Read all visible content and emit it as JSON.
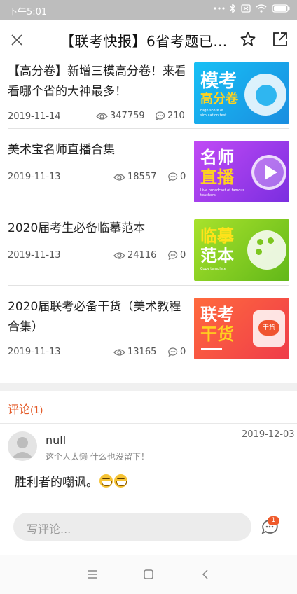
{
  "status_bar": {
    "time": "下午5:01"
  },
  "header": {
    "title": "【联考快报】6省考题已出..."
  },
  "articles": [
    {
      "title": "【高分卷】新增三模高分卷！来看看哪个省的大神最多！",
      "date": "2019-11-14",
      "views": "347759",
      "comments": "210",
      "thumb": {
        "line1": "模考",
        "line2": "高分卷",
        "sub": "High score of simulation test",
        "bg": "#1fb3ea"
      }
    },
    {
      "title": "美术宝名师直播合集",
      "date": "2019-11-13",
      "views": "18557",
      "comments": "0",
      "thumb": {
        "line1": "名师",
        "line2": "直播",
        "sub": "Live broadcast of famous teachers",
        "bg": "#9b3df0"
      }
    },
    {
      "title": "2020届考生必备临摹范本",
      "date": "2019-11-13",
      "views": "24116",
      "comments": "0",
      "thumb": {
        "line1": "临摹",
        "line2": "范本",
        "sub": "Copy template",
        "bg": "#8ad224"
      }
    },
    {
      "title": "2020届联考必备干货（美术教程合集）",
      "date": "2019-11-13",
      "views": "13165",
      "comments": "0",
      "thumb": {
        "line1": "联考",
        "line2": "干货",
        "sub": "",
        "badge": "干货",
        "bg": "#f2513a"
      }
    }
  ],
  "comments_section": {
    "label": "评论",
    "count": "(1)",
    "items": [
      {
        "user": "null",
        "date": "2019-12-03",
        "signature": "这个人太懒 什么也没留下！",
        "text": "胜利者的嘲讽。"
      }
    ]
  },
  "comment_bar": {
    "placeholder": "写评论...",
    "badge": "1"
  },
  "colors": {
    "accent": "#e35a28",
    "badge": "#ef5a2b"
  },
  "icons": [
    "close-icon",
    "star-icon",
    "share-icon",
    "eye-icon",
    "comment-bubble-icon",
    "avatar-placeholder-icon",
    "menu-icon",
    "home-icon",
    "back-icon"
  ]
}
